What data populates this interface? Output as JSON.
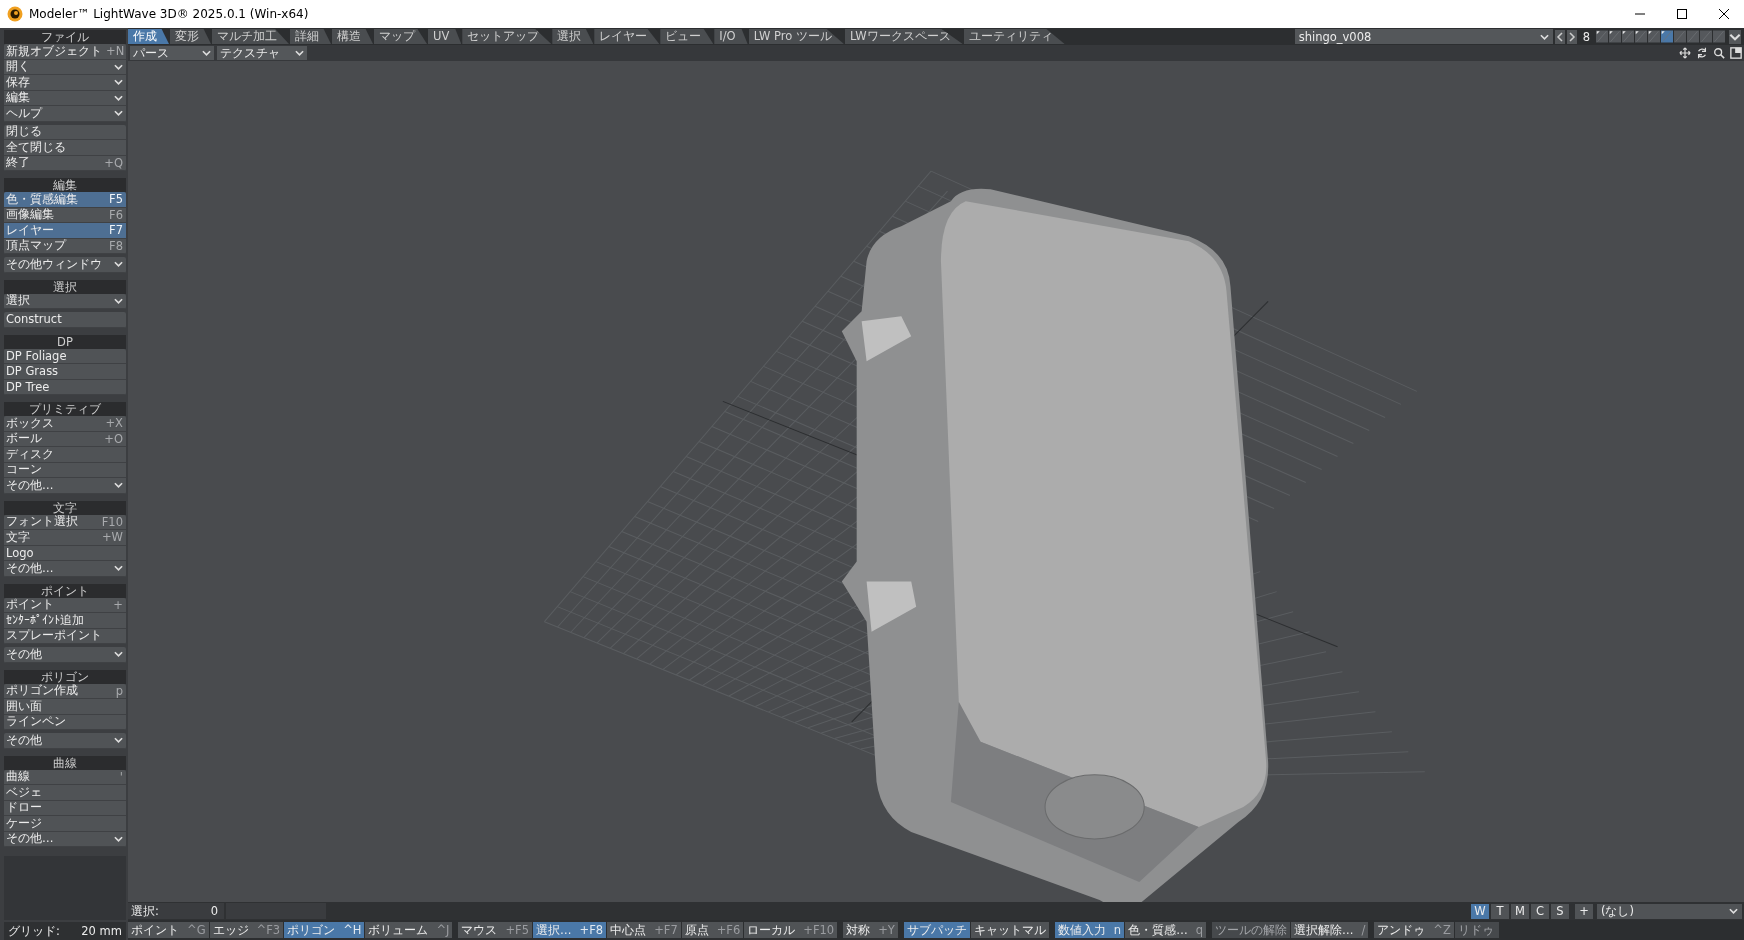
{
  "window": {
    "title": "Modeler™ LightWave 3D® 2025.0.1 (Win-x64)"
  },
  "tabs": [
    {
      "label": "作成",
      "selected": true
    },
    {
      "label": "変形",
      "selected": false
    },
    {
      "label": "マルチ加工",
      "selected": false
    },
    {
      "label": "詳細",
      "selected": false
    },
    {
      "label": "構造",
      "selected": false
    },
    {
      "label": "マップ",
      "selected": false
    },
    {
      "label": "UV",
      "selected": false
    },
    {
      "label": "セットアップ",
      "selected": false
    },
    {
      "label": "選択",
      "selected": false
    },
    {
      "label": "レイヤー",
      "selected": false
    },
    {
      "label": "ビュー",
      "selected": false
    },
    {
      "label": "I/O",
      "selected": false
    },
    {
      "label": "LW Pro ツール",
      "selected": false
    },
    {
      "label": "LWワークスペース",
      "selected": false
    },
    {
      "label": "ユーティリティ",
      "selected": false
    }
  ],
  "viewport_menus": [
    "パース",
    "テクスチャ"
  ],
  "object_menu": "shingo_v008",
  "layer_number": "8",
  "layers": [
    {
      "selected": false,
      "has_data": true
    },
    {
      "selected": false,
      "has_data": true
    },
    {
      "selected": false,
      "has_data": true
    },
    {
      "selected": false,
      "has_data": true
    },
    {
      "selected": false,
      "has_data": true
    },
    {
      "selected": true,
      "has_data": true
    },
    {
      "selected": false,
      "has_data": false
    },
    {
      "selected": false,
      "has_data": false
    },
    {
      "selected": false,
      "has_data": false
    },
    {
      "selected": false,
      "has_data": false
    }
  ],
  "sidebar": [
    {
      "header": "ファイル",
      "groups": [
        [
          {
            "label": "新規オブジェクト",
            "shortcut": "+N",
            "dropdown": false,
            "selected": false
          },
          {
            "label": "開く",
            "dropdown": true,
            "selected": false
          },
          {
            "label": "保存",
            "dropdown": true,
            "selected": false
          },
          {
            "label": "編集",
            "dropdown": true,
            "selected": false
          },
          {
            "label": "ヘルプ",
            "dropdown": true,
            "selected": false
          }
        ],
        [
          {
            "label": "閉じる",
            "dropdown": false,
            "selected": false
          },
          {
            "label": "全て閉じる",
            "dropdown": false,
            "selected": false
          },
          {
            "label": "終了",
            "shortcut": "+Q",
            "dropdown": false,
            "selected": false
          }
        ]
      ]
    },
    {
      "header": "編集",
      "groups": [
        [
          {
            "label": "色・質感編集",
            "shortcut": "F5",
            "dropdown": false,
            "selected": true
          },
          {
            "label": "画像編集",
            "shortcut": "F6",
            "dropdown": false,
            "selected": false
          },
          {
            "label": "レイヤー",
            "shortcut": "F7",
            "dropdown": false,
            "selected": true
          },
          {
            "label": "頂点マップ",
            "shortcut": "F8",
            "dropdown": false,
            "selected": false
          }
        ],
        [
          {
            "label": "その他ウィンドウ",
            "dropdown": true,
            "selected": false
          }
        ]
      ]
    },
    {
      "header": "選択",
      "groups": [
        [
          {
            "label": "選択",
            "dropdown": true,
            "selected": false
          }
        ],
        [
          {
            "label": "Construct",
            "dropdown": false,
            "selected": false
          }
        ]
      ]
    },
    {
      "header": "DP",
      "groups": [
        [
          {
            "label": "DP Foliage",
            "dropdown": false,
            "selected": false
          },
          {
            "label": "DP Grass",
            "dropdown": false,
            "selected": false
          },
          {
            "label": "DP Tree",
            "dropdown": false,
            "selected": false
          }
        ]
      ]
    },
    {
      "header": "プリミティブ",
      "groups": [
        [
          {
            "label": "ボックス",
            "shortcut": "+X",
            "dropdown": false,
            "selected": false
          },
          {
            "label": "ボール",
            "shortcut": "+O",
            "dropdown": false,
            "selected": false
          },
          {
            "label": "ディスク",
            "dropdown": false,
            "selected": false
          },
          {
            "label": "コーン",
            "dropdown": false,
            "selected": false
          },
          {
            "label": "その他…",
            "dropdown": true,
            "selected": false
          }
        ]
      ]
    },
    {
      "header": "文字",
      "groups": [
        [
          {
            "label": "フォント選択",
            "shortcut": "F10",
            "dropdown": false,
            "selected": false
          },
          {
            "label": "文字",
            "shortcut": "+W",
            "dropdown": false,
            "selected": false
          },
          {
            "label": "Logo",
            "dropdown": false,
            "selected": false
          },
          {
            "label": "その他…",
            "dropdown": true,
            "selected": false
          }
        ]
      ]
    },
    {
      "header": "ポイント",
      "groups": [
        [
          {
            "label": "ポイント",
            "shortcut": "+",
            "dropdown": false,
            "selected": false
          },
          {
            "label": "ｾﾝﾀｰﾎﾟｲﾝﾄ追加",
            "dropdown": false,
            "selected": false
          },
          {
            "label": "スプレーポイント",
            "dropdown": false,
            "selected": false
          }
        ],
        [
          {
            "label": "その他",
            "dropdown": true,
            "selected": false
          }
        ]
      ]
    },
    {
      "header": "ポリゴン",
      "groups": [
        [
          {
            "label": "ポリゴン作成",
            "shortcut": "p",
            "dropdown": false,
            "selected": false
          },
          {
            "label": "囲い面",
            "dropdown": false,
            "selected": false
          },
          {
            "label": "ラインペン",
            "dropdown": false,
            "selected": false
          }
        ],
        [
          {
            "label": "その他",
            "dropdown": true,
            "selected": false
          }
        ]
      ]
    },
    {
      "header": "曲線",
      "groups": [
        [
          {
            "label": "曲線",
            "shortcut": "'",
            "dropdown": false,
            "selected": false
          },
          {
            "label": "ベジェ",
            "dropdown": false,
            "selected": false
          },
          {
            "label": "ドロー",
            "dropdown": false,
            "selected": false
          },
          {
            "label": "ケージ",
            "dropdown": false,
            "selected": false
          },
          {
            "label": "その他…",
            "dropdown": true,
            "selected": false
          }
        ]
      ]
    }
  ],
  "grid": {
    "label": "グリッド:",
    "value": "20 mm"
  },
  "selection_info": {
    "label": "選択:",
    "value": "0"
  },
  "view_modes": [
    {
      "label": "W",
      "selected": true
    },
    {
      "label": "T",
      "selected": false
    },
    {
      "label": "M",
      "selected": false
    },
    {
      "label": "C",
      "selected": false
    },
    {
      "label": "S",
      "selected": false
    }
  ],
  "add_button": "+",
  "vmap_menu": "(なし)",
  "bottom_groups": [
    [
      {
        "label": "ポイント",
        "shortcut": "^G",
        "selected": false,
        "disabled": false
      },
      {
        "label": "エッジ",
        "shortcut": "^F3",
        "selected": false,
        "disabled": false
      },
      {
        "label": "ポリゴン",
        "shortcut": "^H",
        "selected": true,
        "disabled": false
      },
      {
        "label": "ボリューム",
        "shortcut": "^J",
        "selected": false,
        "disabled": false
      }
    ],
    [
      {
        "label": "マウス",
        "shortcut": "+F5",
        "selected": false,
        "disabled": false
      },
      {
        "label": "選択…",
        "shortcut": "+F8",
        "selected": true,
        "disabled": false
      },
      {
        "label": "中心点",
        "shortcut": "+F7",
        "selected": false,
        "disabled": false
      },
      {
        "label": "原点",
        "shortcut": "+F6",
        "selected": false,
        "disabled": false
      },
      {
        "label": "ローカル",
        "shortcut": "+F10",
        "selected": false,
        "disabled": false
      }
    ],
    [
      {
        "label": "対称",
        "shortcut": "+Y",
        "selected": false,
        "disabled": false
      }
    ],
    [
      {
        "label": "サブパッチ",
        "selected": true,
        "disabled": false
      },
      {
        "label": "キャットマル",
        "selected": false,
        "disabled": false
      }
    ],
    [
      {
        "label": "数値入力",
        "shortcut": "n",
        "selected": true,
        "disabled": false
      },
      {
        "label": "色・質感…",
        "shortcut": "q",
        "selected": false,
        "disabled": false
      }
    ],
    [
      {
        "label": "ツールの解除",
        "selected": false,
        "disabled": true
      },
      {
        "label": "選択解除…",
        "shortcut": "/",
        "selected": false,
        "disabled": false
      }
    ],
    [
      {
        "label": "アンドゥ",
        "shortcut": "^Z",
        "selected": false,
        "disabled": false
      },
      {
        "label": "リドゥ",
        "selected": false,
        "disabled": true
      }
    ]
  ]
}
